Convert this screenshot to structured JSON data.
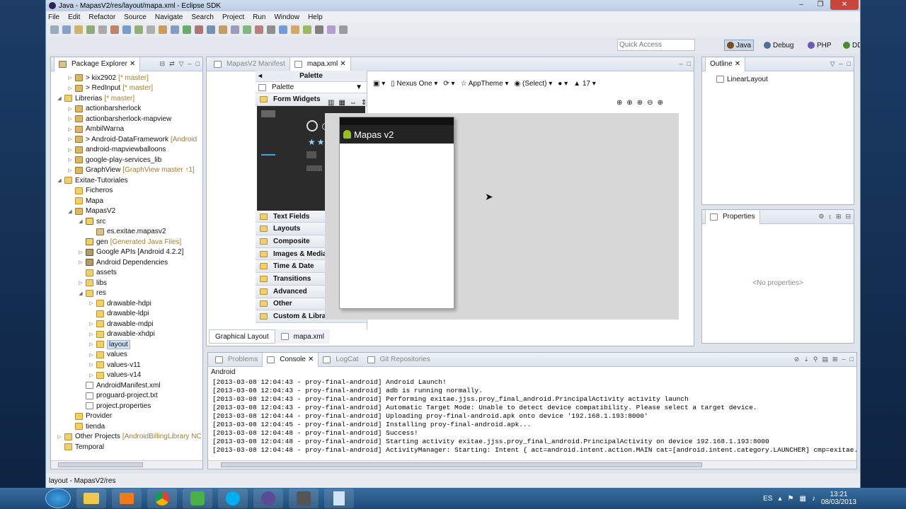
{
  "window": {
    "title": "Java - MapasV2/res/layout/mapa.xml - Eclipse SDK",
    "controls": [
      "–",
      "❐",
      "✕"
    ]
  },
  "menu": [
    "File",
    "Edit",
    "Refactor",
    "Source",
    "Navigate",
    "Search",
    "Project",
    "Run",
    "Window",
    "Help"
  ],
  "quick_access": {
    "placeholder": "Quick Access"
  },
  "perspectives": [
    {
      "label": "Java",
      "active": true,
      "color": "#7a4e1e"
    },
    {
      "label": "Debug",
      "active": false,
      "color": "#4f6f9a"
    },
    {
      "label": "PHP",
      "active": false,
      "color": "#6a5ab0"
    },
    {
      "label": "DDMS",
      "active": false,
      "color": "#4e8a2e"
    }
  ],
  "package_explorer": {
    "tab": "Package Explorer",
    "items": [
      {
        "label": "> kix2902",
        "dec": "[* master]",
        "level": 1,
        "twisty": "▷",
        "icon": "proj"
      },
      {
        "label": "> RedInput",
        "dec": "[* master]",
        "level": 1,
        "twisty": "▷",
        "icon": "proj"
      },
      {
        "label": "Librerias",
        "dec": "[* master]",
        "level": 0,
        "twisty": "◢",
        "icon": "fold"
      },
      {
        "label": "actionbarsherlock",
        "dec": "",
        "level": 1,
        "twisty": "▷",
        "icon": "proj"
      },
      {
        "label": "actionbarsherlock-mapview",
        "dec": "",
        "level": 1,
        "twisty": "▷",
        "icon": "proj"
      },
      {
        "label": "AmbilWarna",
        "dec": "",
        "level": 1,
        "twisty": "▷",
        "icon": "proj"
      },
      {
        "label": "> Android-DataFramework",
        "dec": "[Android",
        "level": 1,
        "twisty": "▷",
        "icon": "proj"
      },
      {
        "label": "android-mapviewballoons",
        "dec": "",
        "level": 1,
        "twisty": "▷",
        "icon": "proj"
      },
      {
        "label": "google-play-services_lib",
        "dec": "",
        "level": 1,
        "twisty": "▷",
        "icon": "proj"
      },
      {
        "label": "GraphView",
        "dec": "[GraphView master ↑1]",
        "level": 1,
        "twisty": "▷",
        "icon": "proj"
      },
      {
        "label": "Exitae-Tutoriales",
        "dec": "",
        "level": 0,
        "twisty": "◢",
        "icon": "fold"
      },
      {
        "label": "Ficheros",
        "dec": "",
        "level": 1,
        "twisty": "",
        "icon": "fold"
      },
      {
        "label": "Mapa",
        "dec": "",
        "level": 1,
        "twisty": "",
        "icon": "fold"
      },
      {
        "label": "MapasV2",
        "dec": "",
        "level": 1,
        "twisty": "◢",
        "icon": "proj"
      },
      {
        "label": "src",
        "dec": "",
        "level": 2,
        "twisty": "◢",
        "icon": "src"
      },
      {
        "label": "es.exitae.mapasv2",
        "dec": "",
        "level": 3,
        "twisty": "",
        "icon": "pkg"
      },
      {
        "label": "gen",
        "dec": "[Generated Java Files]",
        "level": 2,
        "twisty": "",
        "icon": "src"
      },
      {
        "label": "Google APIs [Android 4.2.2]",
        "dec": "",
        "level": 2,
        "twisty": "▷",
        "icon": "lib"
      },
      {
        "label": "Android Dependencies",
        "dec": "",
        "level": 2,
        "twisty": "▷",
        "icon": "lib"
      },
      {
        "label": "assets",
        "dec": "",
        "level": 2,
        "twisty": "",
        "icon": "fold"
      },
      {
        "label": "libs",
        "dec": "",
        "level": 2,
        "twisty": "▷",
        "icon": "fold"
      },
      {
        "label": "res",
        "dec": "",
        "level": 2,
        "twisty": "◢",
        "icon": "fold"
      },
      {
        "label": "drawable-hdpi",
        "dec": "",
        "level": 3,
        "twisty": "▷",
        "icon": "fold"
      },
      {
        "label": "drawable-ldpi",
        "dec": "",
        "level": 3,
        "twisty": "",
        "icon": "fold"
      },
      {
        "label": "drawable-mdpi",
        "dec": "",
        "level": 3,
        "twisty": "▷",
        "icon": "fold"
      },
      {
        "label": "drawable-xhdpi",
        "dec": "",
        "level": 3,
        "twisty": "▷",
        "icon": "fold"
      },
      {
        "label": "layout",
        "dec": "",
        "level": 3,
        "twisty": "▷",
        "icon": "fold",
        "selected": true
      },
      {
        "label": "values",
        "dec": "",
        "level": 3,
        "twisty": "▷",
        "icon": "fold"
      },
      {
        "label": "values-v11",
        "dec": "",
        "level": 3,
        "twisty": "▷",
        "icon": "fold"
      },
      {
        "label": "values-v14",
        "dec": "",
        "level": 3,
        "twisty": "▷",
        "icon": "fold"
      },
      {
        "label": "AndroidManifest.xml",
        "dec": "",
        "level": 2,
        "twisty": "",
        "icon": "file"
      },
      {
        "label": "proguard-project.txt",
        "dec": "",
        "level": 2,
        "twisty": "",
        "icon": "file"
      },
      {
        "label": "project.properties",
        "dec": "",
        "level": 2,
        "twisty": "",
        "icon": "file"
      },
      {
        "label": "Provider",
        "dec": "",
        "level": 1,
        "twisty": "",
        "icon": "fold"
      },
      {
        "label": "tienda",
        "dec": "",
        "level": 1,
        "twisty": "",
        "icon": "fold"
      },
      {
        "label": "Other Projects",
        "dec": "[AndroidBillingLibrary NC",
        "level": 0,
        "twisty": "▷",
        "icon": "fold"
      },
      {
        "label": "Temporal",
        "dec": "",
        "level": 0,
        "twisty": "",
        "icon": "fold"
      }
    ]
  },
  "editor": {
    "tabs": [
      {
        "label": "MapasV2 Manifest",
        "active": false
      },
      {
        "label": "mapa.xml",
        "active": true
      }
    ],
    "palette_header": "Palette",
    "palette_select": "Palette",
    "categories": [
      "Form Widgets",
      "Text Fields",
      "Layouts",
      "Composite",
      "Images & Media",
      "Time & Date",
      "Transitions",
      "Advanced",
      "Other",
      "Custom & Library Views"
    ],
    "device": "Nexus One",
    "theme": "AppTheme",
    "activity": "(Select)",
    "api": "17",
    "app_title": "Mapas v2",
    "bottom_tabs": [
      "Graphical Layout",
      "mapa.xml"
    ]
  },
  "outline": {
    "tab": "Outline",
    "items": [
      "LinearLayout"
    ]
  },
  "properties": {
    "tab": "Properties",
    "empty": "<No properties>"
  },
  "console": {
    "tabs": [
      {
        "label": "Problems",
        "active": false
      },
      {
        "label": "Console",
        "active": true
      },
      {
        "label": "LogCat",
        "active": false
      },
      {
        "label": "Git Repositories",
        "active": false
      }
    ],
    "name": "Android",
    "lines": [
      "[2013-03-08 12:04:43 - proy-final-android] Android Launch!",
      "[2013-03-08 12:04:43 - proy-final-android] adb is running normally.",
      "[2013-03-08 12:04:43 - proy-final-android] Performing exitae.jjss.proy_final_android.PrincipalActivity activity launch",
      "[2013-03-08 12:04:43 - proy-final-android] Automatic Target Mode: Unable to detect device compatibility. Please select a target device.",
      "[2013-03-08 12:04:44 - proy-final-android] Uploading proy-final-android.apk onto device '192.168.1.193:8000'",
      "[2013-03-08 12:04:45 - proy-final-android] Installing proy-final-android.apk...",
      "[2013-03-08 12:04:48 - proy-final-android] Success!",
      "[2013-03-08 12:04:48 - proy-final-android] Starting activity exitae.jjss.proy_final_android.PrincipalActivity on device 192.168.1.193:8000",
      "[2013-03-08 12:04:48 - proy-final-android] ActivityManager: Starting: Intent { act=android.intent.action.MAIN cat=[android.intent.category.LAUNCHER] cmp=exitae."
    ]
  },
  "statusbar": {
    "text": "layout - MapasV2/res"
  },
  "taskbar": {
    "lang": "ES",
    "time": "13:21",
    "date": "08/03/2013"
  }
}
